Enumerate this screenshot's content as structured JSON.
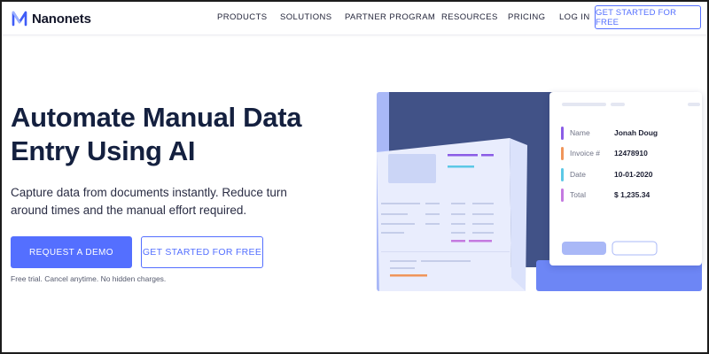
{
  "brand": {
    "name": "Nanonets"
  },
  "nav": {
    "items": [
      {
        "label": "PRODUCTS"
      },
      {
        "label": "SOLUTIONS"
      },
      {
        "label": "PARTNER PROGRAM"
      },
      {
        "label": "RESOURCES"
      },
      {
        "label": "PRICING"
      },
      {
        "label": "LOG IN"
      }
    ],
    "cta_label": "GET STARTED FOR FREE"
  },
  "hero": {
    "title_line1": "Automate Manual Data",
    "title_line2": "Entry Using AI",
    "subtitle_line1": "Capture data from documents instantly. Reduce turn",
    "subtitle_line2": "around times and the manual effort required.",
    "primary_button": "REQUEST A DEMO",
    "secondary_button": "GET STARTED FOR FREE",
    "fine_print": "Free trial. Cancel anytime. No hidden charges."
  },
  "extraction_card": {
    "fields": [
      {
        "label": "Name",
        "value": "Jonah Doug",
        "color": "#8a5ce6"
      },
      {
        "label": "Invoice #",
        "value": "12478910",
        "color": "#f0955a"
      },
      {
        "label": "Date",
        "value": "10-01-2020",
        "color": "#5cc8e6"
      },
      {
        "label": "Total",
        "value": "$ 1,235.34",
        "color": "#c47ae0"
      }
    ]
  },
  "colors": {
    "accent": "#546fff",
    "title": "#14203f",
    "panel_dark": "#415287",
    "panel_light": "#a9b8f7"
  }
}
